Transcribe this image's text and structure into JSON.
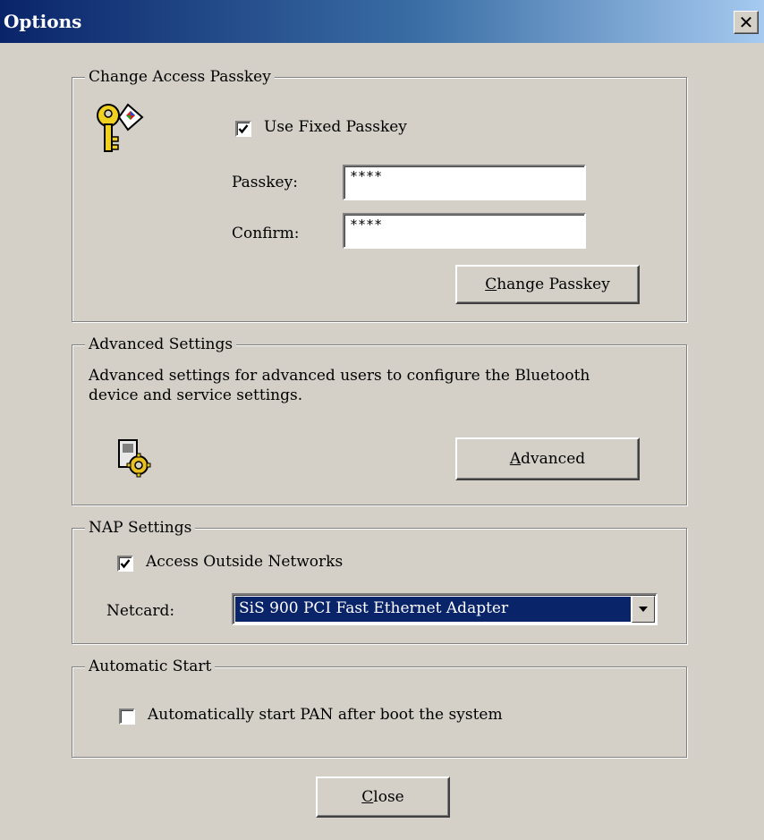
{
  "window": {
    "title": "Options",
    "close_label": "✕"
  },
  "passkey_group": {
    "legend": "Change Access Passkey",
    "use_fixed_label": "Use Fixed Passkey",
    "use_fixed_checked": true,
    "passkey_label": "Passkey:",
    "passkey_value": "****",
    "confirm_label": "Confirm:",
    "confirm_value": "****",
    "change_button_prefix": "C",
    "change_button_rest": "hange Passkey",
    "icon": "key-icon"
  },
  "advanced_group": {
    "legend": "Advanced Settings",
    "description_line1": "Advanced settings for advanced users to configure the Bluetooth",
    "description_line2": "device and service settings.",
    "button_prefix": "A",
    "button_rest": "dvanced",
    "icon": "gear-settings-icon"
  },
  "nap_group": {
    "legend": "NAP Settings",
    "access_outside_label": "Access Outside Networks",
    "access_outside_checked": true,
    "netcard_label": "Netcard:",
    "netcard_value": "SiS 900 PCI Fast Ethernet Adapter"
  },
  "autostart_group": {
    "legend": "Automatic Start",
    "autostart_label": "Automatically start PAN after boot the system",
    "autostart_checked": false
  },
  "footer": {
    "close_prefix": "C",
    "close_rest": "lose"
  },
  "colors": {
    "dialog_bg": "#d4d0c8",
    "title_start": "#0a246a",
    "title_end": "#a6caf0",
    "selection": "#0a246a"
  }
}
